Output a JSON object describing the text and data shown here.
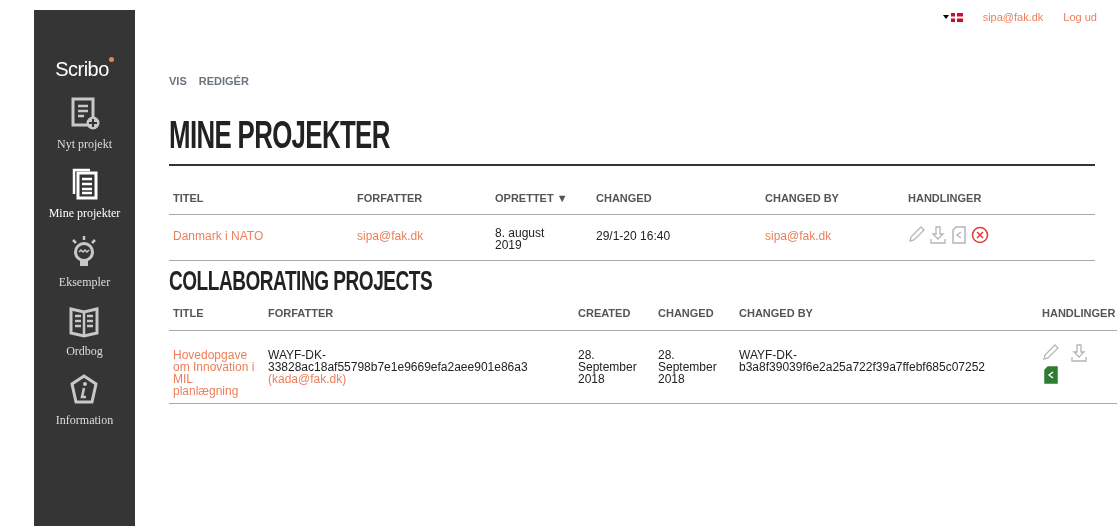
{
  "sidebar": {
    "logo": "Scribo",
    "items": [
      {
        "kind": "new",
        "label": "Nyt projekt",
        "selected": false
      },
      {
        "kind": "projects",
        "label": "Mine projekter",
        "selected": true
      },
      {
        "kind": "examples",
        "label": "Eksempler",
        "selected": false
      },
      {
        "kind": "dictionary",
        "label": "Ordbog",
        "selected": false
      },
      {
        "kind": "info",
        "label": "Information",
        "selected": false
      }
    ]
  },
  "topbar": {
    "user": "sipa@fak.dk",
    "logout": "Log ud"
  },
  "view_tabs": [
    {
      "label": "VIS"
    },
    {
      "label": "REDIGÉR"
    }
  ],
  "my_projects": {
    "title": "MINE PROJEKTER",
    "columns": [
      "TITEL",
      "FORFATTER",
      "OPRETTET ▼",
      "CHANGED",
      "CHANGED BY",
      "HANDLINGER"
    ],
    "rows": [
      {
        "title": "Danmark i NATO",
        "author": "sipa@fak.dk",
        "created": "8. august 2019",
        "changed": "29/1-20 16:40",
        "changed_by": "sipa@fak.dk",
        "actions": [
          {
            "kind": "edit",
            "highlighted": false
          },
          {
            "kind": "download",
            "highlighted": false
          },
          {
            "kind": "share",
            "highlighted": false
          },
          {
            "kind": "delete",
            "highlighted": true
          }
        ]
      }
    ]
  },
  "collaborating": {
    "title": "COLLABORATING PROJECTS",
    "columns": [
      "TITLE",
      "FORFATTER",
      "CREATED",
      "CHANGED",
      "CHANGED BY",
      "HANDLINGER"
    ],
    "rows": [
      {
        "title": "Hovedopgave om Innovation i MIL planlægning",
        "author": "WAYF-DK-33828ac18af55798b7e1e9669efa2aee901e86a3",
        "author_email": "(kada@fak.dk)",
        "created": "28. September 2018",
        "changed": "28. September 2018",
        "changed_by": "WAYF-DK-b3a8f39039f6e2a25a722f39a7ffebf685c07252",
        "actions": [
          {
            "kind": "edit",
            "highlighted": false
          },
          {
            "kind": "download",
            "highlighted": false
          },
          {
            "kind": "share",
            "highlighted": true
          }
        ]
      }
    ]
  }
}
